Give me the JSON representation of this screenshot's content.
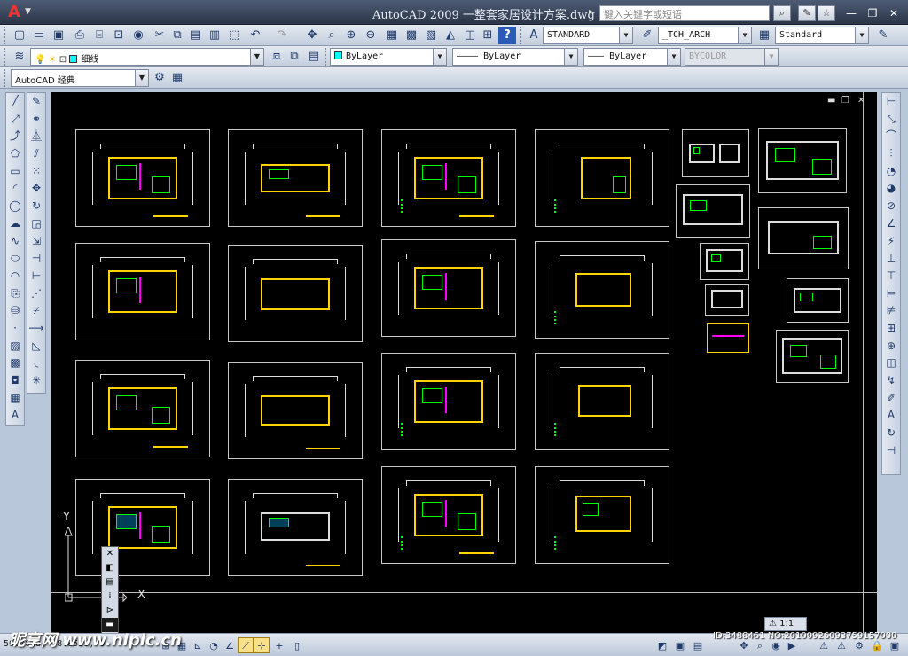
{
  "window": {
    "title": "AutoCAD 2009  一整套家居设计方案.dwg",
    "search_placeholder": "键入关键字或短语"
  },
  "toolbar": {
    "text_style": "STANDARD",
    "dim_style": "_TCH_ARCH",
    "table_style": "Standard",
    "layer": "细线",
    "color": "ByLayer",
    "linetype": "———— ByLayer",
    "lineweight": "——— ByLayer",
    "plotstyle": "BYCOLOR",
    "workspace": "AutoCAD 经典"
  },
  "status": {
    "coordinates": "56.7638, -8.8559, 0",
    "annotation_scale": "1:1"
  },
  "watermark": {
    "site": "昵享网 www.nipic.cn",
    "id": "ID:3488461 NO:20100926093759157000"
  },
  "colors": {
    "canvas": "#000000",
    "wall": "#ffd400",
    "furniture": "#00ff00",
    "accent": "#ff00ff"
  }
}
